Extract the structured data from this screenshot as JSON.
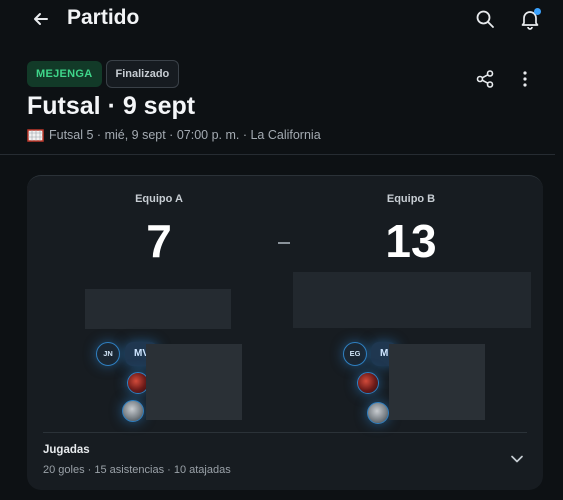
{
  "header": {
    "title": "Partido"
  },
  "match": {
    "type_badge": "MEJENGA",
    "status_badge": "Finalizado",
    "title": "Futsal · 9 sept",
    "meta": "Futsal 5 · mié, 9 sept · 07:00 p. m. · La California"
  },
  "scoreboard": {
    "team_a": {
      "name": "Equipo A",
      "score": "7",
      "initials": "JN",
      "chip": "MV"
    },
    "team_b": {
      "name": "Equipo B",
      "score": "13",
      "initials": "EG",
      "chip": "M"
    }
  },
  "plays": {
    "title": "Jugadas",
    "summary": "20 goles · 15 asistencias · 10 atajadas"
  },
  "colors": {
    "background": "#0d1114",
    "card": "#171c21",
    "accent_green": "#3fd68a",
    "accent_blue": "#2f7fc0",
    "notification_dot": "#3aa3ff"
  },
  "icons": [
    "back-arrow-icon",
    "search-icon",
    "bell-icon",
    "share-icon",
    "more-vertical-icon",
    "goal-icon",
    "chevron-down-icon"
  ]
}
